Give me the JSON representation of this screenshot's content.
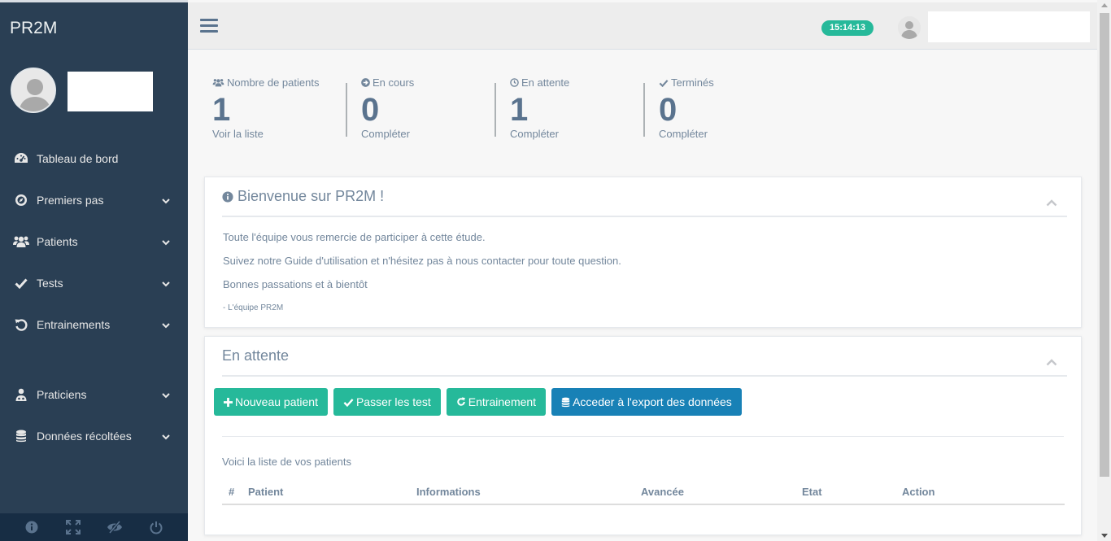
{
  "sidebar": {
    "brand": "PR2M",
    "menu": [
      {
        "label": "Tableau de bord",
        "icon": "dashboard-icon",
        "chevron": false
      },
      {
        "label": "Premiers pas",
        "icon": "compass-icon",
        "chevron": true
      },
      {
        "label": "Patients",
        "icon": "users-icon",
        "chevron": true
      },
      {
        "label": "Tests",
        "icon": "check-icon",
        "chevron": true
      },
      {
        "label": "Entrainements",
        "icon": "undo-icon",
        "chevron": true
      },
      {
        "label": "Praticiens",
        "icon": "user-md-icon",
        "chevron": true
      },
      {
        "label": "Données récoltées",
        "icon": "database-icon",
        "chevron": true
      }
    ],
    "footer_icons": [
      "info-icon",
      "fullscreen-icon",
      "eye-slash-icon",
      "power-icon"
    ]
  },
  "topnav": {
    "clock": "15:14:13"
  },
  "stats": [
    {
      "label": "Nombre de patients",
      "icon": "users-icon",
      "value": "1",
      "sub": "Voir la liste"
    },
    {
      "label": "En cours",
      "icon": "arrow-circle-right-icon",
      "value": "0",
      "sub": "Compléter"
    },
    {
      "label": "En attente",
      "icon": "clock-icon",
      "value": "1",
      "sub": "Compléter"
    },
    {
      "label": "Terminés",
      "icon": "check-icon",
      "value": "0",
      "sub": "Compléter"
    }
  ],
  "welcome": {
    "title": "Bienvenue sur PR2M !",
    "lines": [
      "Toute l'équipe vous remercie de participer à cette étude.",
      "Suivez notre Guide d'utilisation et n'hésitez pas à nous contacter pour toute question.",
      "Bonnes passations et à bientôt"
    ],
    "signature": "- L'équipe PR2M"
  },
  "pending": {
    "title": "En attente",
    "buttons": [
      {
        "label": "Nouveau patient",
        "icon": "plus-icon"
      },
      {
        "label": "Passer les test",
        "icon": "check-icon"
      },
      {
        "label": "Entrainement",
        "icon": "refresh-icon"
      },
      {
        "label": "Acceder à l'export des données",
        "icon": "database-icon"
      }
    ],
    "list_label": "Voici la liste de vos patients",
    "columns": [
      "#",
      "Patient",
      "Informations",
      "Avancée",
      "Etat",
      "Action"
    ]
  },
  "colors": {
    "sidebar": "#2a3f54",
    "accent_green": "#26b99a",
    "accent_blue": "#1881b6",
    "text": "#73879c"
  }
}
